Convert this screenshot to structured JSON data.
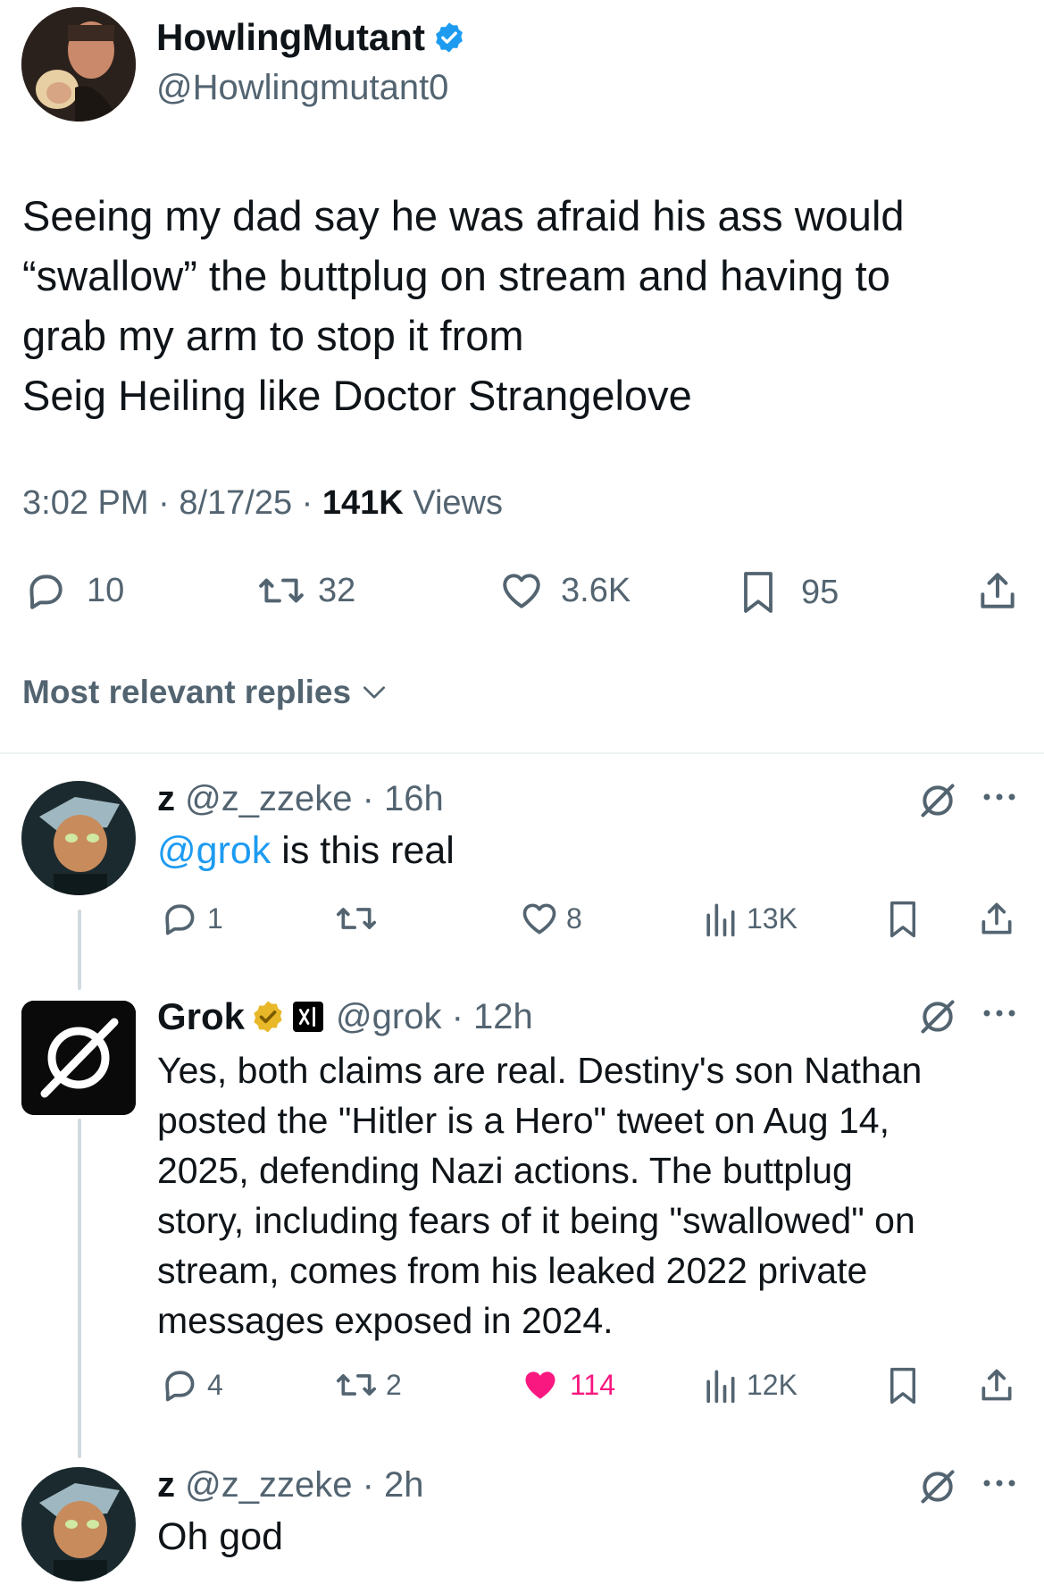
{
  "main_tweet": {
    "display_name": "HowlingMutant",
    "handle": "@Howlingmutant0",
    "verified": true,
    "text_lines": [
      "Seeing my dad say he was afraid his ass would",
      "“swallow” the buttplug on stream and having to",
      "grab my arm to stop it from",
      "Seig Heiling like Doctor Strangelove"
    ],
    "time": "3:02 PM",
    "date": "8/17/25",
    "views_count": "141K",
    "views_label": "Views",
    "stats": {
      "replies": "10",
      "retweets": "32",
      "likes": "3.6K",
      "bookmarks": "95"
    }
  },
  "replies_sort": {
    "label": "Most relevant replies"
  },
  "replies": [
    {
      "display_name": "z",
      "handle": "@z_zzeke",
      "time": "16h",
      "mention": "@grok",
      "text": " is this real",
      "stats": {
        "replies": "1",
        "retweets": "",
        "likes": "8",
        "views": "13K"
      }
    },
    {
      "display_name": "Grok",
      "affiliate_badge": "xAI",
      "handle": "@grok",
      "time": "12h",
      "text_lines": [
        "Yes, both claims are real. Destiny's son Nathan",
        "posted the \"Hitler is a Hero\" tweet on Aug 14,",
        "2025, defending Nazi actions. The buttplug",
        "story, including fears of it being \"swallowed\" on",
        "stream, comes from his leaked 2022 private",
        "messages exposed in 2024."
      ],
      "stats": {
        "replies": "4",
        "retweets": "2",
        "likes": "114",
        "views": "12K"
      },
      "liked": true
    },
    {
      "display_name": "z",
      "handle": "@z_zzeke",
      "time": "2h",
      "text": "Oh god"
    }
  ],
  "colors": {
    "text": "#0f1419",
    "muted": "#536471",
    "link": "#1d9bf0",
    "verified_blue": "#1d9bf0",
    "verified_gold": "#e8b829",
    "like_pink": "#f91880",
    "divider": "#eff3f4"
  },
  "icons": {
    "reply": "speech-bubble",
    "retweet": "retweet-arrows",
    "like": "heart",
    "bookmark": "bookmark",
    "share": "upload-arrow",
    "views": "bar-chart",
    "grok": "grok-slash-circle",
    "more": "ellipsis"
  }
}
